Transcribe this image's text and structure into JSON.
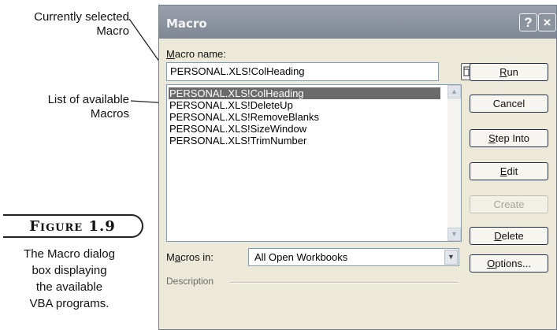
{
  "callouts": {
    "selected_line1": "Currently selected",
    "selected_line2": "Macro",
    "list_line1": "List of available",
    "list_line2": "Macros"
  },
  "figure": {
    "badge": "Figure 1.9",
    "caption_lines": [
      "The Macro dialog",
      "box displaying",
      "the available",
      "VBA programs."
    ]
  },
  "dialog": {
    "title": "Macro",
    "help_glyph": "?",
    "close_glyph": "×",
    "macro_name_label": "Macro name:",
    "macro_name_value": "PERSONAL.XLS!ColHeading",
    "macros": [
      "PERSONAL.XLS!ColHeading",
      "PERSONAL.XLS!DeleteUp",
      "PERSONAL.XLS!RemoveBlanks",
      "PERSONAL.XLS!SizeWindow",
      "PERSONAL.XLS!TrimNumber"
    ],
    "selected_index": 0,
    "macros_in_label": "Macros in:",
    "macros_in_value": "All Open Workbooks",
    "description_label": "Description",
    "buttons": {
      "run": "Run",
      "cancel": "Cancel",
      "step_into": "Step Into",
      "edit": "Edit",
      "create": "Create",
      "delete": "Delete",
      "options": "Options..."
    }
  },
  "colors": {
    "dialog_bg": "#ece9d8",
    "title_bar": "#8b939f",
    "selection": "#6b6b6b"
  },
  "icons": [
    "help-icon",
    "close-icon",
    "collapse-dialog-icon",
    "scroll-up-icon",
    "scroll-down-icon",
    "dropdown-arrow-icon"
  ]
}
